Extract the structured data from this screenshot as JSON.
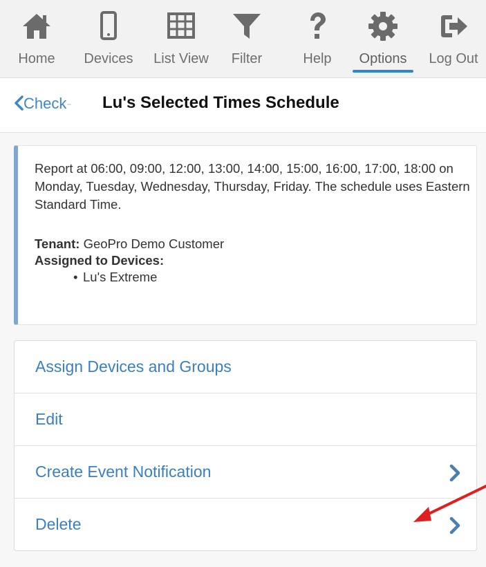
{
  "nav": {
    "items": [
      {
        "key": "home",
        "label": "Home",
        "icon": "home-icon"
      },
      {
        "key": "devices",
        "label": "Devices",
        "icon": "phone-icon"
      },
      {
        "key": "list_view",
        "label": "List View",
        "icon": "grid-icon"
      },
      {
        "key": "filter",
        "label": "Filter",
        "icon": "funnel-icon"
      },
      {
        "key": "help",
        "label": "Help",
        "icon": "question-icon"
      },
      {
        "key": "options",
        "label": "Options",
        "icon": "gear-icon",
        "active": true
      },
      {
        "key": "logout",
        "label": "Log Out",
        "icon": "logout-icon"
      }
    ]
  },
  "header": {
    "back_label": "Check",
    "back_trail": "-",
    "title": "Lu's Selected Times Schedule"
  },
  "schedule": {
    "summary": "Report at 06:00, 09:00, 12:00, 13:00, 14:00, 15:00, 16:00, 17:00, 18:00 on Monday, Tuesday, Wednesday, Thursday, Friday. The schedule uses Eastern Standard Time.",
    "tenant_label": "Tenant:",
    "tenant_value": "GeoPro Demo Customer",
    "assigned_label": "Assigned to Devices:",
    "devices": [
      "Lu's Extreme"
    ]
  },
  "actions": [
    {
      "label": "Assign Devices and Groups",
      "has_chevron": false
    },
    {
      "label": "Edit",
      "has_chevron": false
    },
    {
      "label": "Create Event Notification",
      "has_chevron": true
    },
    {
      "label": "Delete",
      "has_chevron": true
    }
  ],
  "colors": {
    "accent": "#2e85d4",
    "link": "#3a7fbf",
    "nav_icon": "#6b6b6b",
    "card_border": "#7ea6cf",
    "annotation": "#e02020"
  }
}
